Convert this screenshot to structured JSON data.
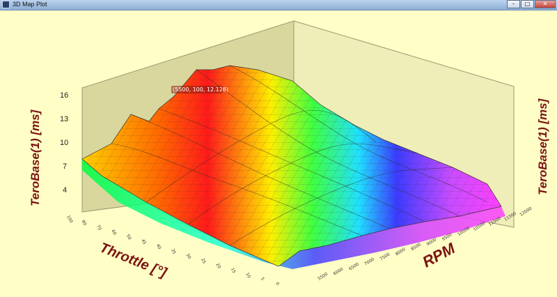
{
  "window": {
    "title": "3D Map Plot",
    "buttons": {
      "minimize": "–",
      "maximize": "□",
      "close": "✕"
    }
  },
  "chart_data": {
    "type": "surface",
    "zlabel_left": "TeroBase(1) [ms]",
    "zlabel_right": "TeroBase(1) [ms]",
    "xlabel": "Throttle [°]",
    "ylabel": "RPM",
    "z_ticks": [
      "16",
      "13",
      "10",
      "7",
      "4"
    ],
    "rpm_ticks": [
      "12000",
      "11500",
      "11000",
      "10500",
      "10000",
      "9500",
      "9000",
      "8500",
      "8000",
      "7500",
      "7000",
      "6500",
      "6000",
      "5500"
    ],
    "throttle_ticks": [
      "100",
      "80",
      "70",
      "60",
      "50",
      "45",
      "40",
      "35",
      "30",
      "25",
      "20",
      "15",
      "10",
      "5",
      "0"
    ],
    "tooltip": "(5500, 100, 12.126)",
    "colormap": [
      "#ff00ff",
      "#4040ff",
      "#00ffff",
      "#00ff00",
      "#ffff00",
      "#ff8000",
      "#ff0000",
      "#ffffff"
    ]
  }
}
